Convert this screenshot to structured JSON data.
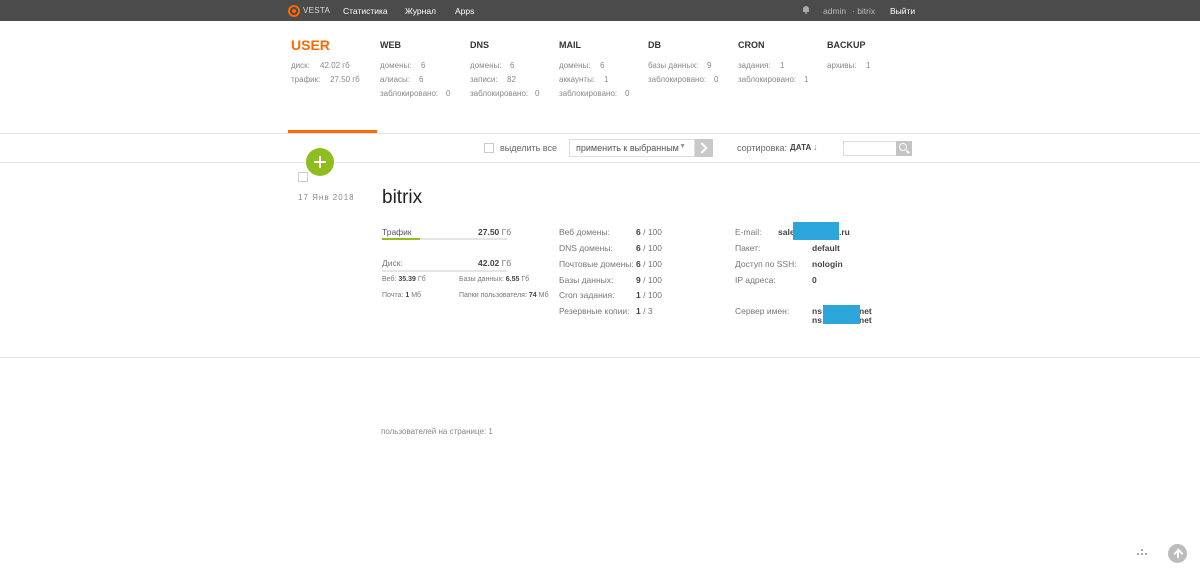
{
  "nav": {
    "logo_text": "VESTA",
    "links": [
      "Статистика",
      "Журнал",
      "Apps"
    ],
    "admin": "admin",
    "separator_user": "· bitrix",
    "logout": "Выйти"
  },
  "stats": {
    "user": {
      "title": "USER",
      "rows": [
        [
          "диск:",
          "42.02 гб"
        ],
        [
          "трафик:",
          "27.50 гб"
        ]
      ]
    },
    "web": {
      "title": "WEB",
      "rows": [
        [
          "домены:",
          "6"
        ],
        [
          "алиасы:",
          "6"
        ],
        [
          "заблокировано:",
          "0"
        ]
      ]
    },
    "dns": {
      "title": "DNS",
      "rows": [
        [
          "домены:",
          "6"
        ],
        [
          "записи:",
          "82"
        ],
        [
          "заблокировано:",
          "0"
        ]
      ]
    },
    "mail": {
      "title": "MAIL",
      "rows": [
        [
          "домены:",
          "6"
        ],
        [
          "аккаунты:",
          "1"
        ],
        [
          "заблокировано:",
          "0"
        ]
      ]
    },
    "db": {
      "title": "DB",
      "rows": [
        [
          "базы данных:",
          "9"
        ],
        [
          "заблокировано:",
          "0"
        ]
      ]
    },
    "cron": {
      "title": "CRON",
      "rows": [
        [
          "задания:",
          "1"
        ],
        [
          "заблокировано:",
          "1"
        ]
      ]
    },
    "backup": {
      "title": "BACKUP",
      "rows": [
        [
          "архивы:",
          "1"
        ]
      ]
    }
  },
  "toolbar": {
    "select_all": "выделить все",
    "bulk_action": "применить к выбранным",
    "sort_label": "сортировка:",
    "sort_value": "ДАТА",
    "sort_arrow": "↓"
  },
  "user_entry": {
    "date": "17 Янв 2018",
    "name": "bitrix",
    "traffic_label": "Трафик",
    "traffic_value": "27.50",
    "traffic_unit": "Гб",
    "traffic_fill": 0.3,
    "disk_label": "Диск:",
    "disk_value": "42.02",
    "disk_unit": "Гб",
    "disk_fill": 0.0,
    "web_label": "Веб:",
    "web_value": "35.39",
    "web_unit": "Гб",
    "db_label": "Базы данных:",
    "db_value": "6.55",
    "db_unit": "Гб",
    "mail_label": "Почта:",
    "mail_value": "1",
    "mail_unit": "Мб",
    "folders_label": "Папки пользователя:",
    "folders_value": "74",
    "folders_unit": "Мб",
    "limits": [
      {
        "label": "Веб домены:",
        "used": "6",
        "max": "/ 100"
      },
      {
        "label": "DNS домены:",
        "used": "6",
        "max": "/ 100"
      },
      {
        "label": "Почтовые домены:",
        "used": "6",
        "max": "/ 100"
      },
      {
        "label": "Базы данных:",
        "used": "9",
        "max": "/ 100"
      },
      {
        "label": "Cron задания:",
        "used": "1",
        "max": "/ 100"
      },
      {
        "label": "Резервные копии:",
        "used": "1",
        "max": "/ 3"
      }
    ],
    "info": {
      "email_label": "E-mail:",
      "email_prefix": "sale",
      "email_suffix": ".ru",
      "package_label": "Пакет:",
      "package_value": "default",
      "ssh_label": "Доступ по SSH:",
      "ssh_value": "nologin",
      "ip_label": "IP адреса:",
      "ip_value": "0",
      "ns_label": "Сервер имен:",
      "ns1_prefix": "ns",
      "ns1_suffix": "net",
      "ns2_prefix": "ns",
      "ns2_suffix": "net"
    }
  },
  "footer": {
    "users_per_page": "пользователей на странице: 1"
  },
  "colors": {
    "accent": "#ff6701",
    "green": "#8fbd1f",
    "redaction": "#2ca5da",
    "topbar": "#4b4b4b"
  }
}
